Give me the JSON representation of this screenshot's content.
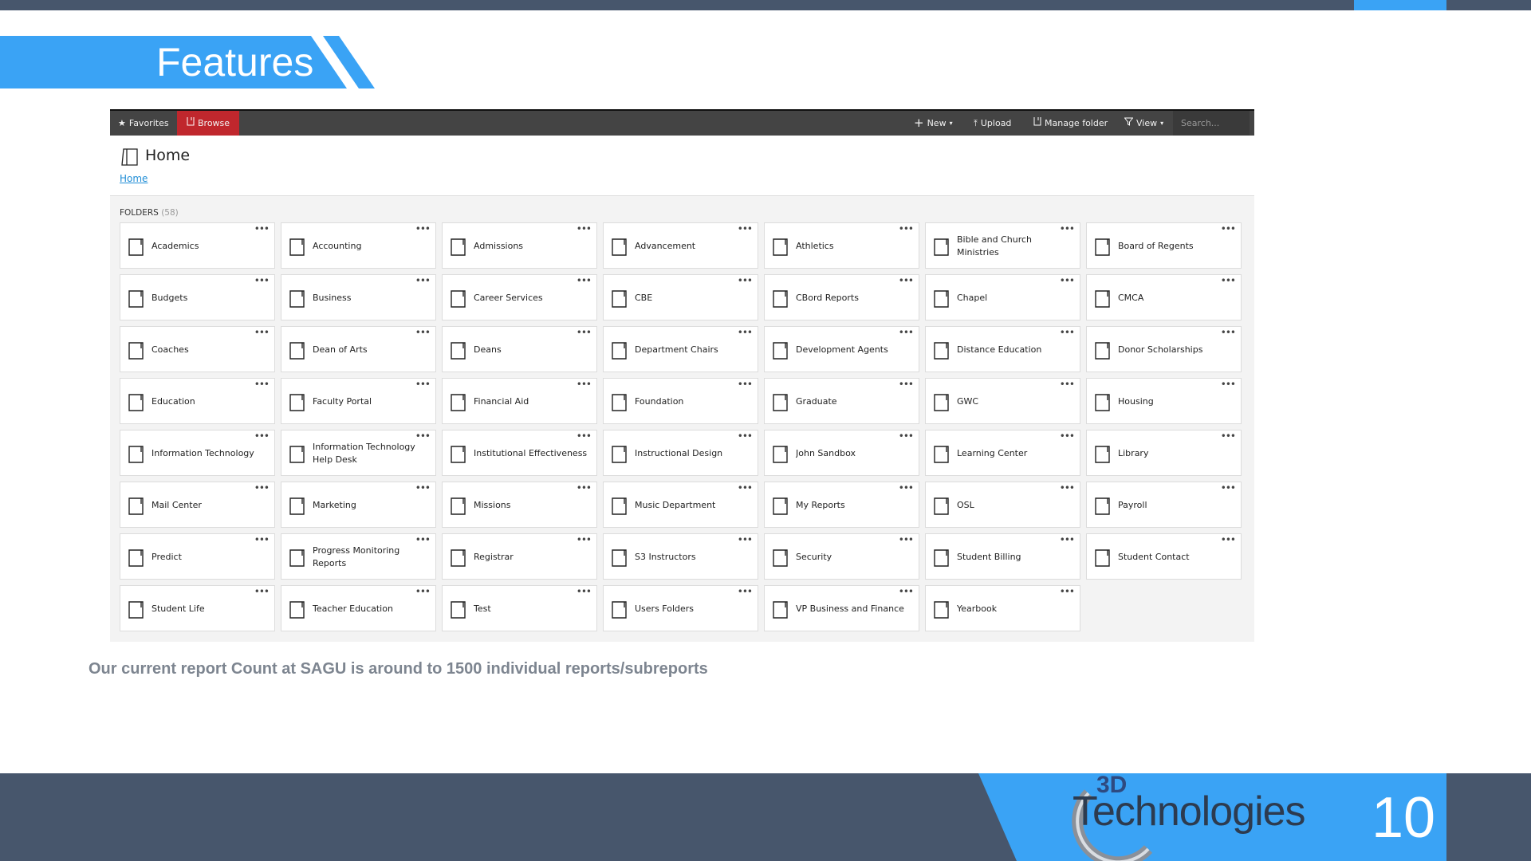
{
  "slide": {
    "title": "Features",
    "caption": "Our current report Count at SAGU is around to 1500 individual reports/subreports",
    "page_number": "10",
    "logo": {
      "prefix": "3D",
      "name": "Technologies"
    },
    "colors": {
      "accent": "#3aa3f5",
      "dark": "#47566c",
      "caption": "#7d8590"
    }
  },
  "app": {
    "toolbar": {
      "favorites": {
        "label": "Favorites",
        "icon": "star-icon"
      },
      "browse": {
        "label": "Browse",
        "icon": "folder-icon",
        "active_color": "#c0272d"
      },
      "new": {
        "label": "New",
        "icon": "plus-icon"
      },
      "upload": {
        "label": "Upload",
        "icon": "upload-icon"
      },
      "manage_folder": {
        "label": "Manage folder",
        "icon": "folder-icon"
      },
      "view": {
        "label": "View",
        "icon": "filter-icon"
      },
      "search_placeholder": "Search..."
    },
    "page_title": "Home",
    "breadcrumb": "Home",
    "folders_label": "FOLDERS",
    "folders_count": "(58)",
    "more_label": "•••",
    "folders": [
      "Academics",
      "Accounting",
      "Admissions",
      "Advancement",
      "Athletics",
      "Bible and Church Ministries",
      "Board of Regents",
      "Budgets",
      "Business",
      "Career Services",
      "CBE",
      "CBord Reports",
      "Chapel",
      "CMCA",
      "Coaches",
      "Dean of Arts",
      "Deans",
      "Department Chairs",
      "Development Agents",
      "Distance Education",
      "Donor Scholarships",
      "Education",
      "Faculty Portal",
      "Financial Aid",
      "Foundation",
      "Graduate",
      "GWC",
      "Housing",
      "Information Technology",
      "Information Technology Help Desk",
      "Institutional Effectiveness",
      "Instructional Design",
      "John Sandbox",
      "Learning Center",
      "Library",
      "Mail Center",
      "Marketing",
      "Missions",
      "Music Department",
      "My Reports",
      "OSL",
      "Payroll",
      "Predict",
      "Progress Monitoring Reports",
      "Registrar",
      "S3 Instructors",
      "Security",
      "Student Billing",
      "Student Contact",
      "Student Life",
      "Teacher Education",
      "Test",
      "Users Folders",
      "VP Business and Finance",
      "Yearbook"
    ]
  }
}
